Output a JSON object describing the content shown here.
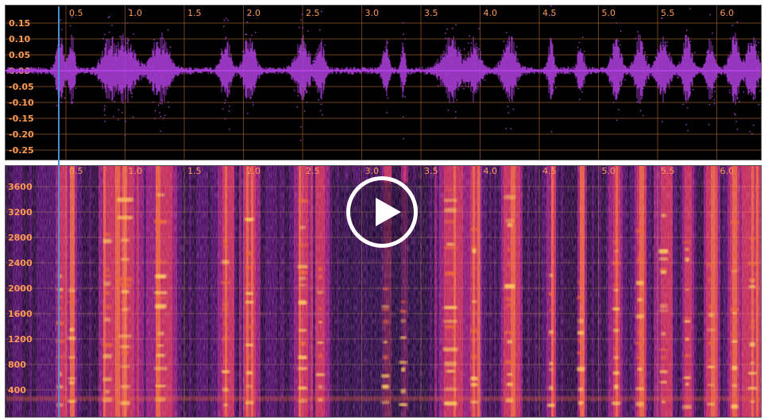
{
  "waveform": {
    "time_ticks": [
      "0.5",
      "1.0",
      "1.5",
      "2.0",
      "2.5",
      "3.0",
      "3.5",
      "4.0",
      "4.5",
      "5.0",
      "5.5",
      "6.0"
    ],
    "amplitude_ticks": [
      "0.15",
      "0.10",
      "0.05",
      "0.00",
      "-0.05",
      "-0.10",
      "-0.15",
      "-0.20",
      "-0.25"
    ],
    "wave_color": "#b040e0",
    "grid_color": "#b06a2a",
    "tick_color": "#ff9a52"
  },
  "spectrogram": {
    "time_ticks": [
      "0.5",
      "1.0",
      "1.5",
      "2.0",
      "2.5",
      "3.0",
      "3.5",
      "4.0",
      "4.5",
      "5.0",
      "5.5",
      "6.0"
    ],
    "frequency_ticks": [
      "3600",
      "3200",
      "2800",
      "2400",
      "2000",
      "1600",
      "1200",
      "800",
      "400"
    ],
    "colormap": [
      "#15083a",
      "#3a0d68",
      "#8a1a7a",
      "#c8305a",
      "#f06a3a",
      "#ffd060"
    ]
  },
  "player": {
    "play_icon": "play-icon",
    "cursor_time": 0.45,
    "cursor_color": "#4a8fd6"
  }
}
